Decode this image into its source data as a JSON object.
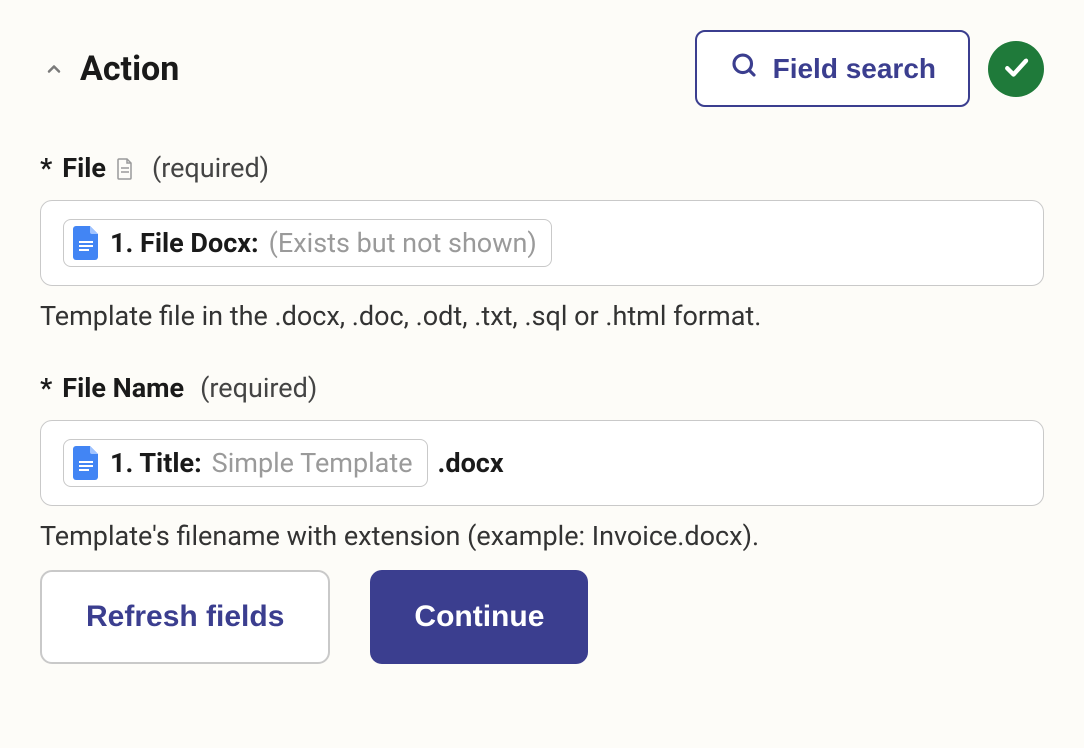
{
  "header": {
    "title": "Action",
    "field_search_label": "Field search"
  },
  "fields": {
    "file": {
      "asterisk": "*",
      "label": "File",
      "required": "(required)",
      "token_label": "1. File Docx:",
      "token_value": "(Exists but not shown)",
      "help": "Template file in the .docx, .doc, .odt, .txt, .sql or .html format."
    },
    "filename": {
      "asterisk": "*",
      "label": "File Name",
      "required": "(required)",
      "token_label": "1. Title:",
      "token_value": "Simple Template",
      "suffix": ".docx",
      "help": "Template's filename with extension (example: Invoice.docx)."
    }
  },
  "buttons": {
    "refresh": "Refresh fields",
    "continue": "Continue"
  }
}
